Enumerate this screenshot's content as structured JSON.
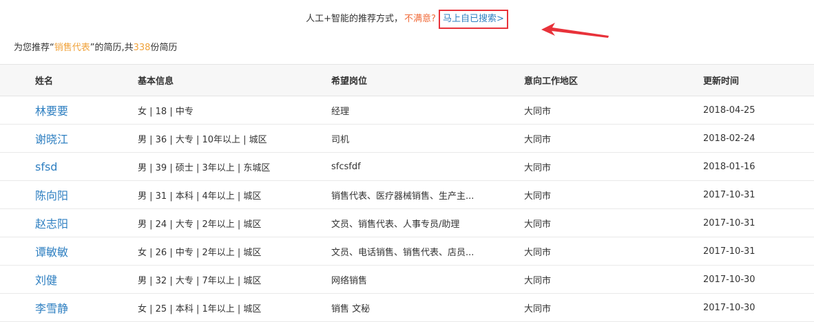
{
  "topbar": {
    "prefix": "人工+智能的推荐方式，",
    "unsatisfied": "不满意?",
    "search_link": "马上自已搜索>"
  },
  "summary": {
    "prefix": "为您推荐“",
    "keyword": "销售代表",
    "middle": "”的简历,共",
    "count": "338",
    "suffix": "份简历"
  },
  "table": {
    "headers": [
      "姓名",
      "基本信息",
      "希望岗位",
      "意向工作地区",
      "更新时间"
    ],
    "rows": [
      {
        "name": "林要要",
        "info": "女 | 18 | 中专",
        "position": "经理",
        "area": "大同市",
        "updated": "2018-04-25"
      },
      {
        "name": "谢晓江",
        "info": "男 | 36 | 大专 | 10年以上 | 城区",
        "position": "司机",
        "area": "大同市",
        "updated": "2018-02-24"
      },
      {
        "name": "sfsd",
        "info": "男 | 39 | 硕士 | 3年以上 | 东城区",
        "position": "sfcsfdf",
        "area": "大同市",
        "updated": "2018-01-16"
      },
      {
        "name": "陈向阳",
        "info": "男 | 31 | 本科 | 4年以上 | 城区",
        "position": "销售代表、医疗器械销售、生产主...",
        "area": "大同市",
        "updated": "2017-10-31"
      },
      {
        "name": "赵志阳",
        "info": "男 | 24 | 大专 | 2年以上 | 城区",
        "position": "文员、销售代表、人事专员/助理",
        "area": "大同市",
        "updated": "2017-10-31"
      },
      {
        "name": "谭敏敏",
        "info": "女 | 26 | 中专 | 2年以上 | 城区",
        "position": "文员、电话销售、销售代表、店员...",
        "area": "大同市",
        "updated": "2017-10-31"
      },
      {
        "name": "刘健",
        "info": "男 | 32 | 大专 | 7年以上 | 城区",
        "position": "网络销售",
        "area": "大同市",
        "updated": "2017-10-30"
      },
      {
        "name": "李雪静",
        "info": "女 | 25 | 本科 | 1年以上 | 城区",
        "position": "销售 文秘",
        "area": "大同市",
        "updated": "2017-10-30"
      }
    ]
  },
  "colors": {
    "link": "#2e7fc1",
    "highlight": "#f0a23a",
    "unsatisfied": "#f06b3a",
    "annotation_red": "#e8323a"
  }
}
